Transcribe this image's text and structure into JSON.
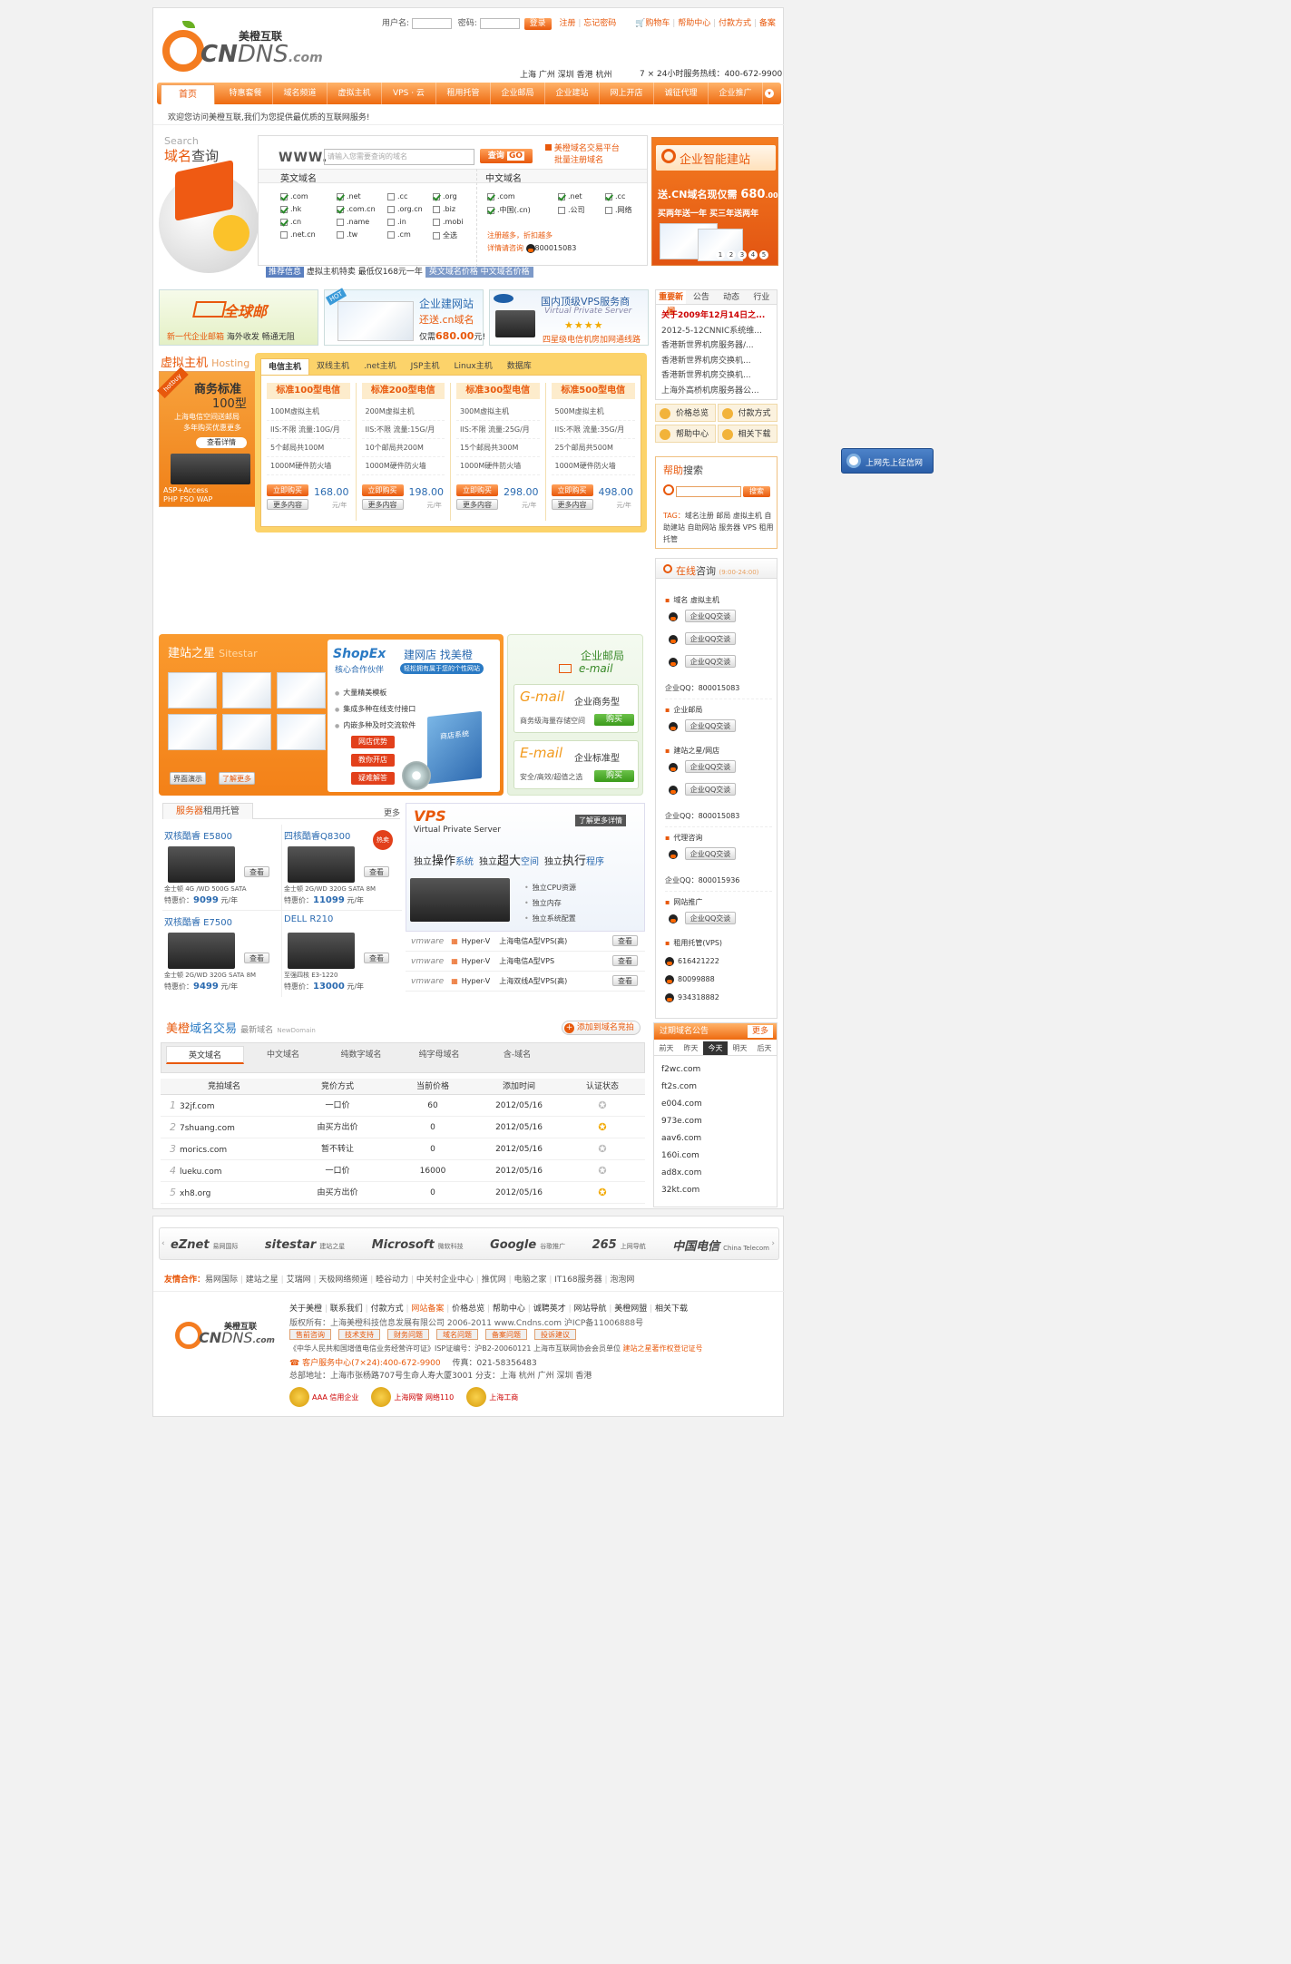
{
  "header": {
    "logo_cn": "美橙互联",
    "logo_en_cn": "CN",
    "logo_en_dns": "DNS",
    "logo_en_com": ".com",
    "user_label": "用户名:",
    "pass_label": "密码:",
    "login_btn": "登录",
    "register": "注册",
    "forgot": "忘记密码",
    "cart": "购物车",
    "help": "帮助中心",
    "payment": "付款方式",
    "beian": "备案",
    "cities": "上海  广州  深圳  香港  杭州",
    "hotline": "7 × 24小时服务热线：400-672-9900"
  },
  "nav": [
    "首页",
    "特惠套餐",
    "域名频道",
    "虚拟主机",
    "VPS · 云",
    "租用托管",
    "企业邮局",
    "企业建站",
    "网上开店",
    "诚征代理",
    "企业推广"
  ],
  "welcome": "欢迎您访问美橙互联,我们为您提供最优质的互联网服务!",
  "domain_search": {
    "search_en": "Search",
    "title_a": "域名",
    "title_b": "查询",
    "www": "WWW.",
    "placeholder": "请输入您需要查询的域名",
    "query_btn": "查询",
    "trade_link": "美橙域名交易平台",
    "bulk_link": "批量注册域名",
    "en_head": "英文域名",
    "cn_head": "中文域名",
    "en": [
      {
        "t": ".com",
        "on": true
      },
      {
        "t": ".net",
        "on": true
      },
      {
        "t": ".cc",
        "on": false
      },
      {
        "t": ".org",
        "on": true
      },
      {
        "t": ".hk",
        "on": true
      },
      {
        "t": ".com.cn",
        "on": true
      },
      {
        "t": ".org.cn",
        "on": false
      },
      {
        "t": ".biz",
        "on": false
      },
      {
        "t": ".cn",
        "on": true
      },
      {
        "t": ".name",
        "on": false
      },
      {
        "t": ".in",
        "on": false
      },
      {
        "t": ".mobi",
        "on": false
      },
      {
        "t": ".net.cn",
        "on": false
      },
      {
        "t": ".tw",
        "on": false
      },
      {
        "t": ".cm",
        "on": false
      },
      {
        "t": "全选",
        "on": false
      }
    ],
    "cn": [
      {
        "t": ".com",
        "on": true
      },
      {
        "t": ".net",
        "on": true
      },
      {
        "t": ".cc",
        "on": true
      },
      {
        "t": ".中国(.cn)",
        "on": true
      },
      {
        "t": ".公司",
        "on": false
      },
      {
        "t": ".网络",
        "on": false
      }
    ],
    "promo1": "注册越多，折扣越多",
    "promo2": "详情请咨询",
    "qq_num": "800015083",
    "rec_label": "推荐信息",
    "rec_text": "虚拟主机特卖 最低仅168元一年",
    "rec_btn": "英文域名价格 中文域名价格"
  },
  "build_ad": {
    "title": "企业智能建站",
    "l1": "送.CN域名现仅需",
    "price": "680",
    "unit": ".00",
    "l2": "买两年送一年  买三年送两年",
    "dots": [
      "1",
      "2",
      "3",
      "4",
      "5"
    ]
  },
  "banners": {
    "mail": {
      "brand": "全球邮",
      "l1": "新一代企业邮箱",
      "l2": "海外收发",
      "l3": "畅通无阻"
    },
    "site": {
      "hot": "HOT",
      "t1": "企业建网站",
      "t2": "还送.cn域名",
      "t3": "仅需",
      "price": "680.00",
      "t4": "元!"
    },
    "vps": {
      "t1": "国内顶级VPS服务商",
      "t2": "Virtual Private Server",
      "t3": "四星级电信机房加网通线路"
    }
  },
  "news": {
    "tabs": [
      "重要新闻",
      "公告",
      "动态",
      "行业"
    ],
    "items": [
      "关于2009年12月14日之...",
      "2012-5-12CNNIC系统维...",
      "香港新世界机房服务器/...",
      "香港新世界机房交换机...",
      "香港新世界机房交换机...",
      "上海外高桥机房服务器公..."
    ]
  },
  "quick": [
    "价格总览",
    "付款方式",
    "帮助中心",
    "相关下载"
  ],
  "hosting": {
    "title": "虚拟主机",
    "en": "Hosting",
    "tabs": [
      "电信主机",
      "双线主机",
      ".net主机",
      "JSP主机",
      "Linux主机",
      "数据库"
    ],
    "ad": {
      "hot": "hotbuy",
      "t1": "商务标准",
      "t2": "100型",
      "t3": "上海电信空间送邮局",
      "t4": "多年购买优惠更多",
      "btn": "查看详情",
      "t5": "ASP+Access",
      "t6": "PHP FSO WAP"
    },
    "plans": [
      {
        "name": "标准100型电信",
        "f": [
          "100M虚拟主机",
          "IIS:不限 流量:10G/月",
          "5个邮局共100M",
          "1000M硬件防火墙"
        ],
        "price": "168.00"
      },
      {
        "name": "标准200型电信",
        "f": [
          "200M虚拟主机",
          "IIS:不限 流量:15G/月",
          "10个邮局共200M",
          "1000M硬件防火墙"
        ],
        "price": "198.00"
      },
      {
        "name": "标准300型电信",
        "f": [
          "300M虚拟主机",
          "IIS:不限 流量:25G/月",
          "15个邮局共300M",
          "1000M硬件防火墙"
        ],
        "price": "298.00"
      },
      {
        "name": "标准500型电信",
        "f": [
          "500M虚拟主机",
          "IIS:不限 流量:35G/月",
          "25个邮局共500M",
          "1000M硬件防火墙"
        ],
        "price": "498.00"
      }
    ],
    "buy": "立即购买",
    "more": "更多内容",
    "unit": "元/年"
  },
  "help_search": {
    "title_a": "帮助",
    "title_b": "搜索",
    "btn": "搜索",
    "tag_label": "TAG：",
    "tags": "域名注册 邮局 虚拟主机 自助建站 自助网站 服务器 VPS 租用 托管"
  },
  "credit": "上网先上征信网",
  "consult": {
    "title_a": "在线",
    "title_b": "咨询",
    "hours": "(9:00-24:00)",
    "qq_label": "企业QQ交谈",
    "g1": "域名 虚拟主机",
    "q1": "企业QQ：800015083",
    "g2": "企业邮局",
    "g3": "建站之星/网店",
    "q2": "企业QQ：800015083",
    "g4": "代理咨询",
    "q3": "企业QQ：800015936",
    "g5": "网站推广",
    "g6": "租用托管(VPS)",
    "nums": [
      "616421222",
      "80099888",
      "934318882"
    ]
  },
  "sitestar": {
    "title_a": "建站",
    "title_b": "之星",
    "en": "Sitestar",
    "shopex": "ShopEx",
    "s1": "建网店 找美橙",
    "s2": "核心合作伙伴",
    "s3": "轻松拥有属于您的个性网站",
    "f": [
      "大量精美模板",
      "集成多种在线支付接口",
      "内嵌多种及时交流软件"
    ],
    "btns": [
      "网店优势",
      "教你开店",
      "疑难解答"
    ],
    "b1": "界面演示",
    "b2": "了解更多",
    "box": "商店系统"
  },
  "email": {
    "title": "企业邮局",
    "en": "e-mail",
    "p1": {
      "name": "企业商务型",
      "desc": "商务级海量存储空间",
      "logo": "G-mail"
    },
    "p2": {
      "name": "企业标准型",
      "desc": "安全/高效/超值之选",
      "logo": "E-mail"
    },
    "buy": "购买"
  },
  "servers": {
    "title_a": "服务器",
    "title_b": "租用托管",
    "more": "更多",
    "view": "查看",
    "price_label": "特惠价：",
    "unit": "元/年",
    "items": [
      {
        "name": "双核酷睿 E5800",
        "spec": "金士顿 4G /WD 500G SATA",
        "price": "9099",
        "hot": false
      },
      {
        "name": "四核酷睿Q8300",
        "spec": "金士顿 2G/WD 320G SATA 8M",
        "price": "11099",
        "hot": true,
        "hot_label": "热卖"
      },
      {
        "name": "双核酷睿 E7500",
        "spec": "金士顿 2G/WD 320G SATA 8M",
        "price": "9499",
        "hot": false
      },
      {
        "name": "DELL R210",
        "spec": "至强四核 E3-1220",
        "price": "13000",
        "hot": false
      }
    ]
  },
  "vps": {
    "logo": "VPS",
    "sub": "Virtual Private Server",
    "more": "了解更多详情",
    "slogan": [
      "独立",
      "操作",
      "系统",
      "独立",
      "超大",
      "空间",
      "独立",
      "执行",
      "程序"
    ],
    "f": [
      "独立CPU资源",
      "独立内存",
      "独立系统配置"
    ],
    "rows": [
      {
        "name": "上海电信A型VPS(高)"
      },
      {
        "name": "上海电信A型VPS"
      },
      {
        "name": "上海双线A型VPS(高)"
      }
    ],
    "vm": "vmware",
    "hv": "Hyper-V",
    "view": "查看"
  },
  "trade": {
    "title_a": "美橙",
    "title_b": "域名交易",
    "sub": "最新域名",
    "sub_en": "NewDomain",
    "add": "添加到域名竞拍",
    "tabs": [
      "英文域名",
      "中文域名",
      "纯数字域名",
      "纯字母域名",
      "含-域名"
    ],
    "cols": [
      "竞拍域名",
      "竞价方式",
      "当前价格",
      "添加时间",
      "认证状态"
    ],
    "rows": [
      {
        "n": "1",
        "d": "32jf.com",
        "m": "一口价",
        "p": "60",
        "t": "2012/05/16",
        "c": false
      },
      {
        "n": "2",
        "d": "7shuang.com",
        "m": "由买方出价",
        "p": "0",
        "t": "2012/05/16",
        "c": true
      },
      {
        "n": "3",
        "d": "morics.com",
        "m": "暂不转让",
        "p": "0",
        "t": "2012/05/16",
        "c": false
      },
      {
        "n": "4",
        "d": "lueku.com",
        "m": "一口价",
        "p": "16000",
        "t": "2012/05/16",
        "c": false
      },
      {
        "n": "5",
        "d": "xh8.org",
        "m": "由买方出价",
        "p": "0",
        "t": "2012/05/16",
        "c": true
      }
    ]
  },
  "expired": {
    "title": "过期域名公告",
    "more": "更多",
    "tabs": [
      "前天",
      "昨天",
      "今天",
      "明天",
      "后天"
    ],
    "items": [
      "f2wc.com",
      "ft2s.com",
      "e004.com",
      "973e.com",
      "aav6.com",
      "160i.com",
      "ad8x.com",
      "32kt.com"
    ]
  },
  "partners": {
    "logos": [
      {
        "a": "eZnet",
        "b": "易网国际"
      },
      {
        "a": "sitestar",
        "b": "建站之星"
      },
      {
        "a": "Microsoft",
        "b": "微软科技"
      },
      {
        "a": "Google",
        "b": "谷歌推广"
      },
      {
        "a": "265",
        "b": "上网导航"
      },
      {
        "a": "中国电信",
        "b": "China Telecom"
      }
    ],
    "label": "友情合作：",
    "links": [
      "易网国际",
      "建站之星",
      "艾瑞网",
      "天极网络频道",
      "睦谷动力",
      "中关村企业中心",
      "推优网",
      "电脑之家",
      "IT168服务器",
      "泡泡网"
    ]
  },
  "footer": {
    "links": [
      "关于美橙",
      "联系我们",
      "付款方式",
      "网站备案",
      "价格总览",
      "帮助中心",
      "诚聘英才",
      "网站导航",
      "美橙网盟",
      "相关下载"
    ],
    "copy": "版权所有：上海美橙科技信息发展有限公司 2006-2011 www.Cndns.com  沪ICP备11006888号",
    "btns": [
      "售前咨询",
      "技术支持",
      "财务问题",
      "域名问题",
      "备案问题",
      "投诉建议"
    ],
    "license": "《中华人民共和国增值电信业务经营许可证》ISP证编号：沪B2-20060121  上海市互联网协会会员单位",
    "sitestar_reg": "建站之星著作权登记证号",
    "service": "客户服务中心(7×24):400-672-9900",
    "fax": "传真：021-58356483",
    "address": "总部地址：上海市张杨路707号生命人寿大厦3001  分支：上海 杭州 广州 深圳 香港",
    "badges": [
      "AAA 信用企业",
      "上海网警 网络110",
      "上海工商"
    ]
  }
}
